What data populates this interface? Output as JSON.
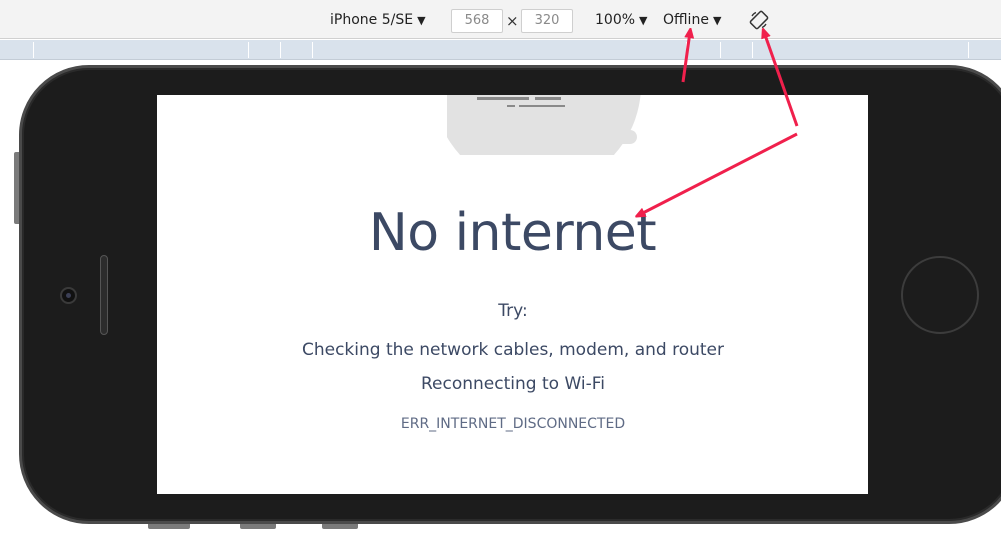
{
  "toolbar": {
    "device_label": "iPhone 5/SE",
    "width_value": "568",
    "height_value": "320",
    "times_symbol": "×",
    "zoom_label": "100%",
    "network_label": "Offline",
    "caret": "▼"
  },
  "page": {
    "heading": "No internet",
    "try_label": "Try:",
    "suggestions": [
      "Checking the network cables, modem, and router",
      "Reconnecting to Wi-Fi"
    ],
    "error_code": "ERR_INTERNET_DISCONNECTED"
  },
  "colors": {
    "annotation_arrow": "#f0204c",
    "text": "#3c4964",
    "ruler": "#d9e2ec",
    "device_frame": "#1c1c1c"
  },
  "icons": {
    "rotate": "rotate-icon",
    "offline_illustration": "no-connection-cloud-icon"
  }
}
